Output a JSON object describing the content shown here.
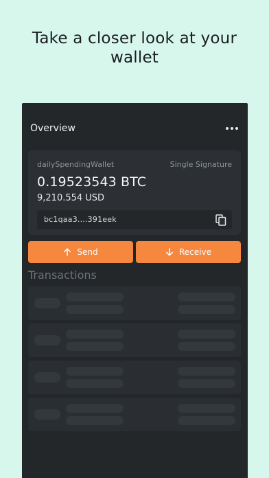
{
  "headline": {
    "line1": "Take a closer look at your",
    "line2": "wallet"
  },
  "topbar": {
    "title": "Overview",
    "menu_icon": "more-horizontal-icon"
  },
  "wallet": {
    "name": "dailySpendingWallet",
    "type": "Single Signature",
    "btc_balance": "0.19523543 BTC",
    "usd_balance": "9,210.554 USD",
    "address": "bc1qaa3....391eek",
    "copy_icon": "copy-icon"
  },
  "actions": {
    "send_label": "Send",
    "receive_label": "Receive",
    "send_icon": "arrow-up-icon",
    "receive_icon": "arrow-down-icon"
  },
  "transactions": {
    "title": "Transactions",
    "placeholder_rows": 4
  },
  "colors": {
    "background": "#d7f7ed",
    "panel": "#23272a",
    "card": "#2c3034",
    "accent": "#f5873e"
  }
}
